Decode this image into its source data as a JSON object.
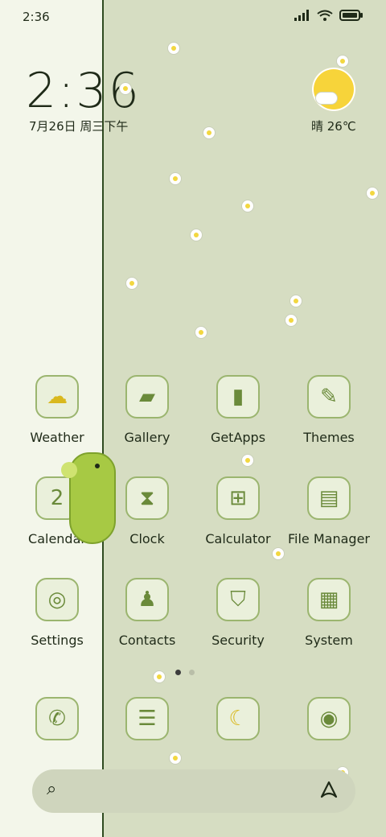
{
  "status": {
    "time": "2:36",
    "icons": [
      "signal-icon",
      "wifi-icon",
      "battery-icon"
    ]
  },
  "clock_widget": {
    "time": "2:36",
    "date": "7月26日 周三下午"
  },
  "weather_widget": {
    "condition_icon": "sunny-cloud-icon",
    "text": "晴 26℃"
  },
  "apps": [
    {
      "label": "Weather",
      "icon": "weather-icon"
    },
    {
      "label": "Gallery",
      "icon": "gallery-icon"
    },
    {
      "label": "GetApps",
      "icon": "getapps-icon"
    },
    {
      "label": "Themes",
      "icon": "themes-icon"
    },
    {
      "label": "Calendar",
      "icon": "calendar-icon",
      "badge": "2"
    },
    {
      "label": "Clock",
      "icon": "hourglass-icon"
    },
    {
      "label": "Calculator",
      "icon": "calculator-icon"
    },
    {
      "label": "File Manager",
      "icon": "folder-icon"
    },
    {
      "label": "Settings",
      "icon": "settings-icon"
    },
    {
      "label": "Contacts",
      "icon": "contacts-icon"
    },
    {
      "label": "Security",
      "icon": "shield-icon"
    },
    {
      "label": "System",
      "icon": "system-folder-icon"
    }
  ],
  "page_indicator": {
    "pages": 2,
    "active": 1
  },
  "dock": [
    {
      "icon": "phone-icon"
    },
    {
      "icon": "messages-icon"
    },
    {
      "icon": "browser-icon"
    },
    {
      "icon": "camera-icon"
    }
  ],
  "search_bar": {
    "icon": "search-icon",
    "assistant_icon": "assistant-icon"
  },
  "colors": {
    "accent_green": "#9bb56f",
    "background": "#d6ddc2",
    "sun_yellow": "#f7d43a"
  }
}
